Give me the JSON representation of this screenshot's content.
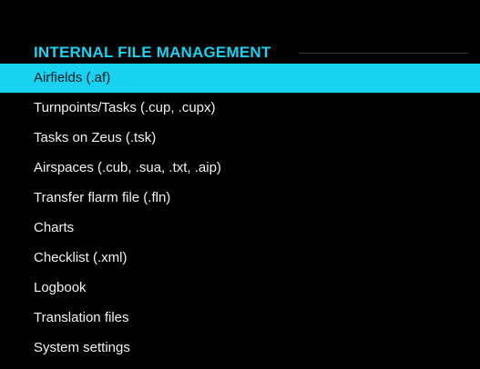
{
  "header": {
    "title": "INTERNAL FILE MANAGEMENT"
  },
  "menu": {
    "selected_index": 0,
    "items": [
      {
        "label": "Airfields (.af)"
      },
      {
        "label": "Turnpoints/Tasks (.cup, .cupx)"
      },
      {
        "label": "Tasks on Zeus (.tsk)"
      },
      {
        "label": "Airspaces (.cub, .sua, .txt, .aip)"
      },
      {
        "label": "Transfer flarm file (.fln)"
      },
      {
        "label": "Charts"
      },
      {
        "label": "Checklist (.xml)"
      },
      {
        "label": "Logbook"
      },
      {
        "label": "Translation files"
      },
      {
        "label": "System settings"
      }
    ]
  },
  "colors": {
    "background": "#000000",
    "accent": "#19d2f0",
    "text": "#f2f2f2",
    "selected_text": "#0d1b22",
    "divider": "#3a3a3a"
  }
}
